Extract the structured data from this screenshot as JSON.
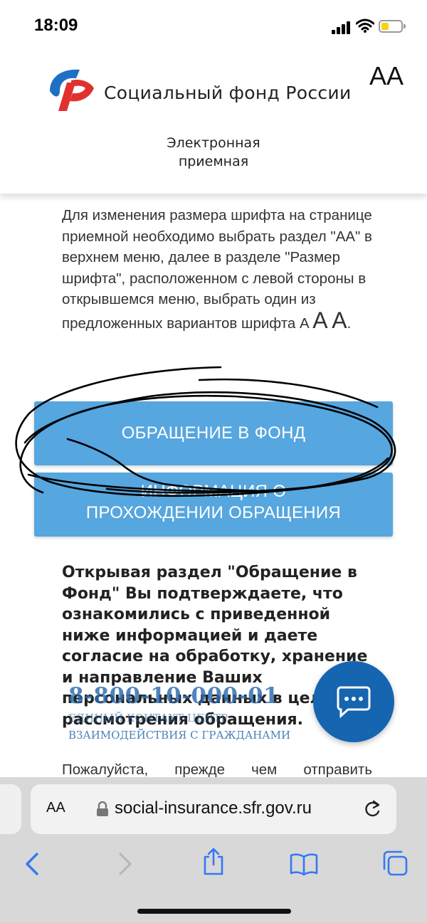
{
  "status_bar": {
    "time": "18:09"
  },
  "header": {
    "org_name": "Социальный фонд России",
    "font_size_button": "AA",
    "section_title_line1": "Электронная",
    "section_title_line2": "приемная"
  },
  "instructions": {
    "text": "Для изменения размера шрифта на странице приемной необходимо выбрать раздел \"АА\" в верхнем меню, далее в разделе \"Размер шрифта\", расположенном с левой стороны в открывшемся меню, выбрать один из предложенных вариантов шрифта",
    "font_option_1": "A",
    "font_option_2": "A",
    "font_option_3": "A",
    "end": "."
  },
  "buttons": {
    "appeal": "ОБРАЩЕНИЕ В ФОНД",
    "status_line1": "ИНФОРМАЦИЯ О",
    "status_line2": "ПРОХОЖДЕНИИ ОБРАЩЕНИЯ"
  },
  "consent_text": "Открывая раздел \"Обращение в Фонд\" Вы подтверждаете, что ознакомились с приведенной ниже информацией и даете согласие на обработку, хранение и направление Ваших персональных данных в целях рассмотрения обращения.",
  "contact_center": {
    "phone": "8-800-10-000-01",
    "line1": "ЕДИНЫЙ КОНТАКТ-ЦЕНТР",
    "line2": "ВЗАИМОДЕЙСТВИЯ С ГРАЖДАНАМИ"
  },
  "partial_text": "Пожалуйста, прежде чем отправить",
  "browser": {
    "aa": "AA",
    "url": "social-insurance.sfr.gov.ru"
  },
  "icons": [
    "logo-icon",
    "chat-icon",
    "lock-icon",
    "reload-icon",
    "back-icon",
    "forward-icon",
    "share-icon",
    "bookmarks-icon",
    "tabs-icon"
  ],
  "colors": {
    "button": "#56a6df",
    "chat": "#1565b0",
    "logo_blue": "#1f6fc5",
    "logo_red": "#e0312f"
  }
}
